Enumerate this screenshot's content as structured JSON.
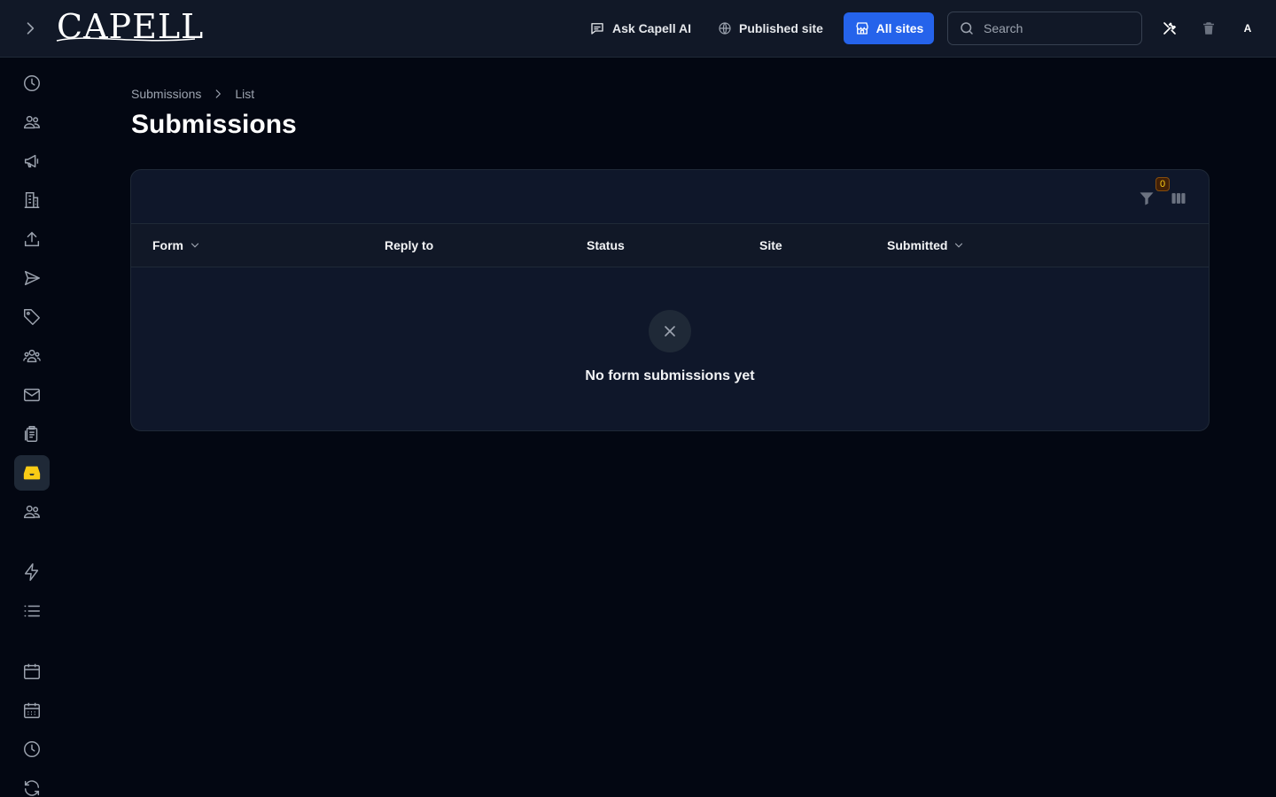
{
  "header": {
    "logo_text": "CAPELL",
    "ask_ai_label": "Ask Capell AI",
    "published_site_label": "Published site",
    "all_sites_label": "All sites",
    "search_placeholder": "Search",
    "avatar_initial": "A"
  },
  "sidebar": {
    "items": [
      {
        "icon": "clock-icon"
      },
      {
        "icon": "users-icon"
      },
      {
        "icon": "megaphone-icon"
      },
      {
        "icon": "building-icon"
      },
      {
        "icon": "upload-icon"
      },
      {
        "icon": "paper-plane-icon"
      },
      {
        "icon": "tag-icon"
      },
      {
        "icon": "user-group-icon"
      },
      {
        "icon": "envelope-icon"
      },
      {
        "icon": "clipboard-icon"
      },
      {
        "icon": "inbox-icon",
        "active": true
      },
      {
        "icon": "users-icon"
      },
      {
        "icon": "bolt-icon"
      },
      {
        "icon": "list-icon"
      },
      {
        "icon": "calendar-icon"
      },
      {
        "icon": "calendar-days-icon"
      },
      {
        "icon": "clock-icon"
      },
      {
        "icon": "refresh-icon"
      }
    ]
  },
  "breadcrumb": {
    "parent": "Submissions",
    "current": "List"
  },
  "page": {
    "title": "Submissions"
  },
  "table": {
    "filter_count": "0",
    "columns": [
      "Form",
      "Reply to",
      "Status",
      "Site",
      "Submitted"
    ],
    "empty_message": "No form submissions yet"
  },
  "colors": {
    "background": "#030712",
    "topbar": "#111827",
    "accent_blue": "#2563eb",
    "active_item": "#facc15"
  }
}
